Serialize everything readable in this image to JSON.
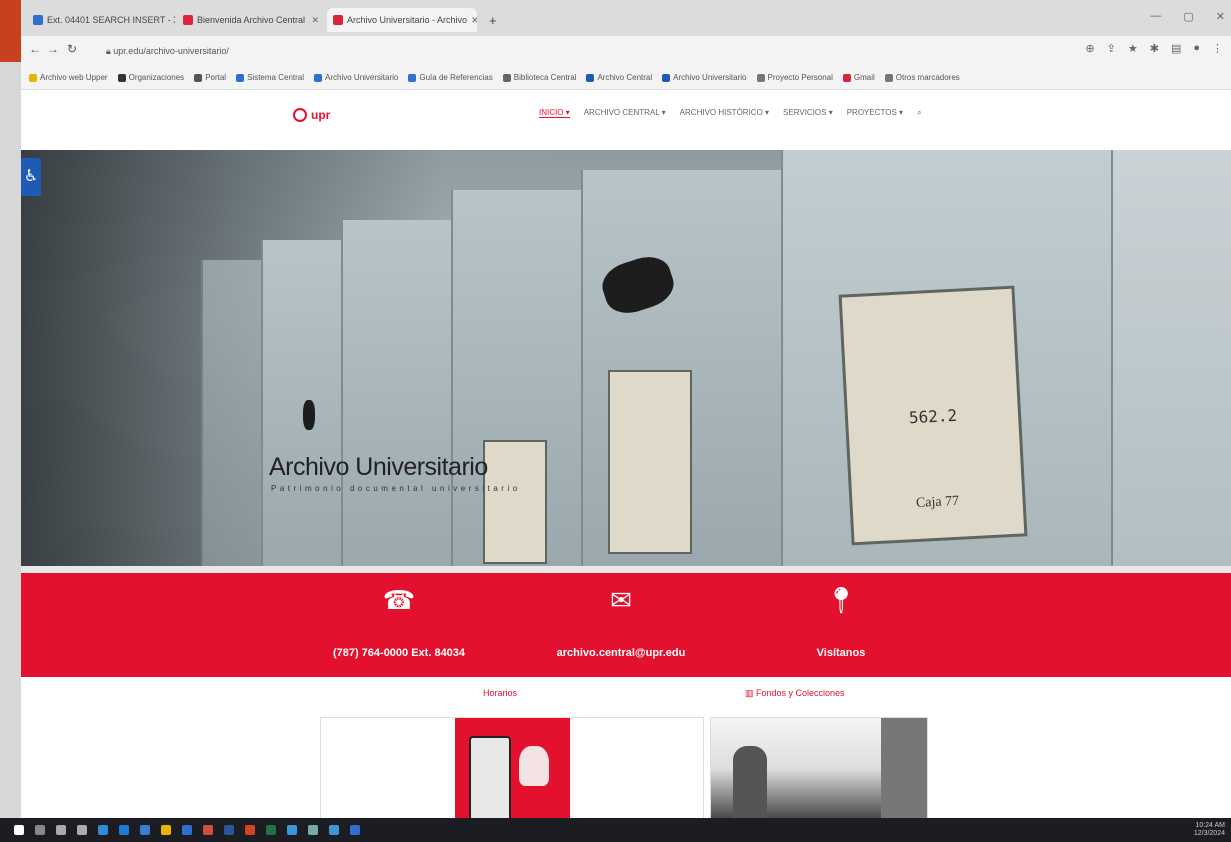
{
  "browser": {
    "tabs": [
      {
        "title": "Ext. 04401 SEARCH INSERT - X"
      },
      {
        "title": "Bienvenida Archivo Central"
      },
      {
        "title": "Archivo Universitario - Archivo"
      }
    ],
    "new_tab": "+",
    "url": "upr.edu/archivo-universitario/",
    "window_controls": [
      "—",
      "▢",
      "✕"
    ],
    "bookmarks": [
      "Archivo web Upper",
      "Organizaciones",
      "Portal",
      "Sistema Central",
      "Archivo Universitario",
      "Guía de Referencias",
      "Biblioteca Central",
      "Archivo Central",
      "Archivo Universitario",
      "Proyecto Personal",
      "Gmail",
      "Otros marcadores"
    ]
  },
  "site": {
    "logo_text": "upr",
    "nav": [
      "INICIO",
      "ARCHIVO CENTRAL",
      "ARCHIVO HISTÓRICO",
      "SERVICIOS",
      "PROYECTOS"
    ],
    "hero_title": "Archivo Universitario",
    "hero_subtitle": "Patrimonio documental universitario",
    "label_number": "562.2",
    "label_box": "Caja 77",
    "contact": {
      "phone": "(787) 764-0000 Ext. 84034",
      "email": "archivo.central@upr.edu",
      "visit": "Visítanos"
    },
    "links": [
      "Horarios",
      "Fondos y Colecciones"
    ],
    "colors": {
      "brand": "#e3112d",
      "accessibility": "#1d5bb5"
    }
  },
  "taskbar": {
    "time": "10:24 AM",
    "date": "12/3/2024"
  }
}
